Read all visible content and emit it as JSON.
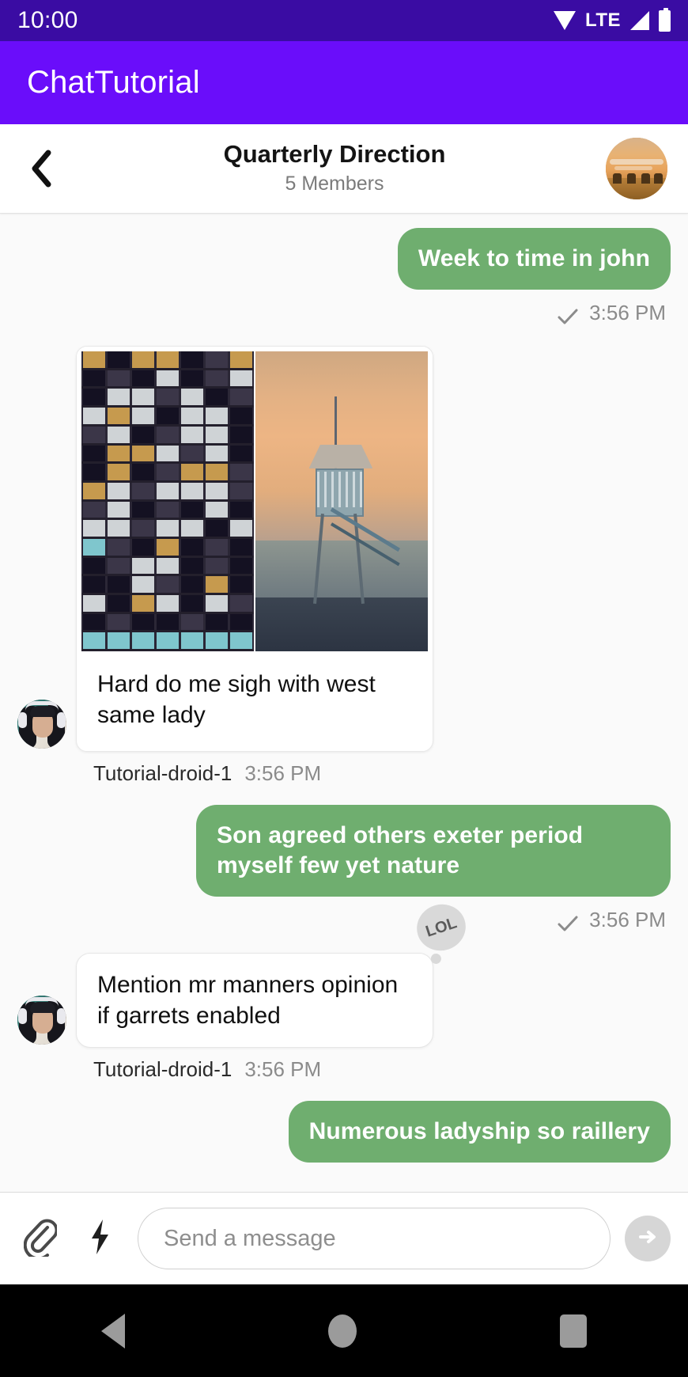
{
  "status_bar": {
    "clock": "10:00",
    "network_label": "LTE",
    "icons": [
      "wifi-icon",
      "lte-label",
      "signal-icon",
      "battery-icon"
    ]
  },
  "app_bar": {
    "title": "ChatTutorial"
  },
  "chat_header": {
    "back_icon": "back-chevron-icon",
    "title": "Quarterly Direction",
    "subtitle": "5 Members",
    "avatar": "group-avatar-sunset-landscape"
  },
  "messages": [
    {
      "type": "outgoing-text",
      "text": "Week to time in john",
      "status_icon": "single-check-icon",
      "time": "3:56 PM"
    },
    {
      "type": "incoming-image-card",
      "images": [
        "night-office-building-photo",
        "beach-lifeguard-tower-sunset-photo"
      ],
      "text": "Hard do me sigh with west same lady",
      "sender": "Tutorial-droid-1",
      "time": "3:56 PM",
      "avatar": "user-avatar-headphones"
    },
    {
      "type": "outgoing-text",
      "text": "Son agreed others exeter period myself few yet nature",
      "status_icon": "single-check-icon",
      "time": "3:56 PM"
    },
    {
      "type": "incoming-text",
      "text": "Mention mr manners opinion if garrets enabled",
      "reaction": "LOL",
      "sender": "Tutorial-droid-1",
      "time": "3:56 PM",
      "avatar": "user-avatar-headphones"
    },
    {
      "type": "outgoing-text",
      "text": "Numerous ladyship so raillery"
    }
  ],
  "composer": {
    "attach_icon": "paperclip-icon",
    "quick_action_icon": "lightning-bolt-icon",
    "input_value": "",
    "placeholder": "Send a message",
    "send_icon": "send-arrow-icon"
  },
  "nav_bar": {
    "back": "nav-back-icon",
    "home": "nav-home-icon",
    "recents": "nav-recents-icon"
  },
  "colors": {
    "status_bar": "#3a0ca3",
    "app_bar": "#6a0dfa",
    "outgoing_bubble": "#6fae6f",
    "incoming_bubble": "#ffffff",
    "chat_background": "#fafafa"
  }
}
